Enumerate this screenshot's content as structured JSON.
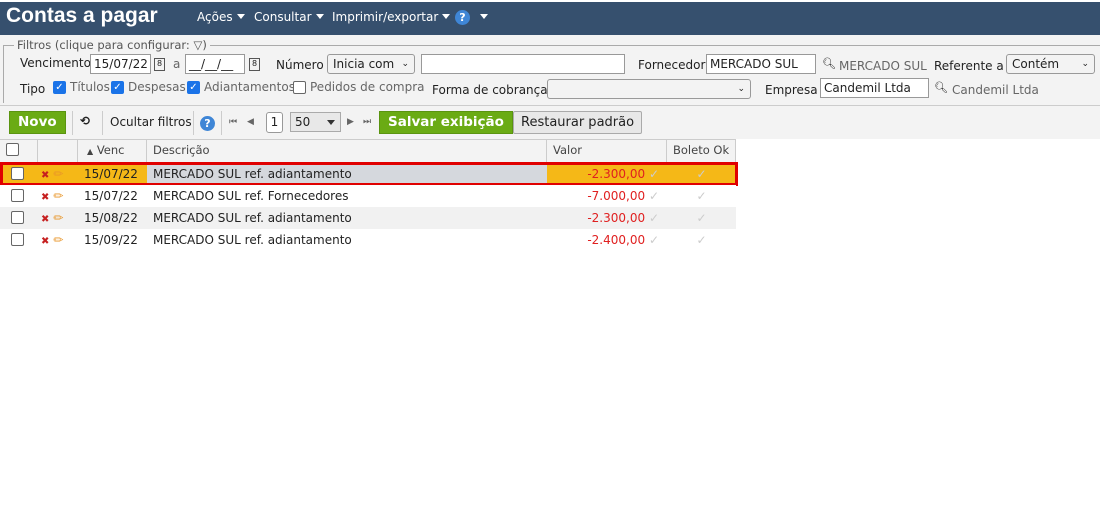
{
  "header": {
    "title": "Contas a pagar",
    "menus": [
      "Ações",
      "Consultar",
      "Imprimir/exportar"
    ]
  },
  "filters": {
    "legend": "Filtros (clique para configurar:",
    "legend_end": ")",
    "vencimento_label": "Vencimento",
    "vencimento_from": "15/07/22",
    "a_label": "a",
    "vencimento_to": "__/__/__",
    "numero_label": "Número",
    "numero_mode": "Inicia com",
    "numero_value": "",
    "fornecedor_label": "Fornecedor",
    "fornecedor_value": "MERCADO SUL",
    "fornecedor_lookup": "MERCADO SUL",
    "referente_label": "Referente a",
    "referente_mode": "Contém",
    "tipo_label": "Tipo",
    "tipos": [
      {
        "label": "Títulos",
        "checked": true
      },
      {
        "label": "Despesas",
        "checked": true
      },
      {
        "label": "Adiantamentos",
        "checked": true
      },
      {
        "label": "Pedidos de compra",
        "checked": false
      }
    ],
    "forma_label": "Forma de cobrança",
    "forma_value": "",
    "empresa_label": "Empresa",
    "empresa_value": "Candemil Ltda",
    "empresa_lookup": "Candemil Ltda"
  },
  "toolbar": {
    "novo": "Novo",
    "ocultar": "Ocultar filtros",
    "page": "1",
    "page_size": "50",
    "salvar": "Salvar exibição",
    "restaurar": "Restaurar padrão"
  },
  "table": {
    "columns": {
      "venc": "Venc",
      "descricao": "Descrição",
      "valor": "Valor",
      "boleto": "Boleto Ok"
    },
    "rows": [
      {
        "venc": "15/07/22",
        "descricao": "MERCADO SUL ref. adiantamento",
        "valor": "-2.300,00",
        "selected": true
      },
      {
        "venc": "15/07/22",
        "descricao": "MERCADO SUL ref. Fornecedores",
        "valor": "-7.000,00",
        "selected": false
      },
      {
        "venc": "15/08/22",
        "descricao": "MERCADO SUL ref. adiantamento",
        "valor": "-2.300,00",
        "selected": false
      },
      {
        "venc": "15/09/22",
        "descricao": "MERCADO SUL ref. adiantamento",
        "valor": "-2.400,00",
        "selected": false
      }
    ]
  },
  "colors": {
    "topbar": "#36506e",
    "green": "#6aab14",
    "highlight": "#f5b817",
    "selection_border": "#e00000",
    "negative": "#e02020"
  }
}
